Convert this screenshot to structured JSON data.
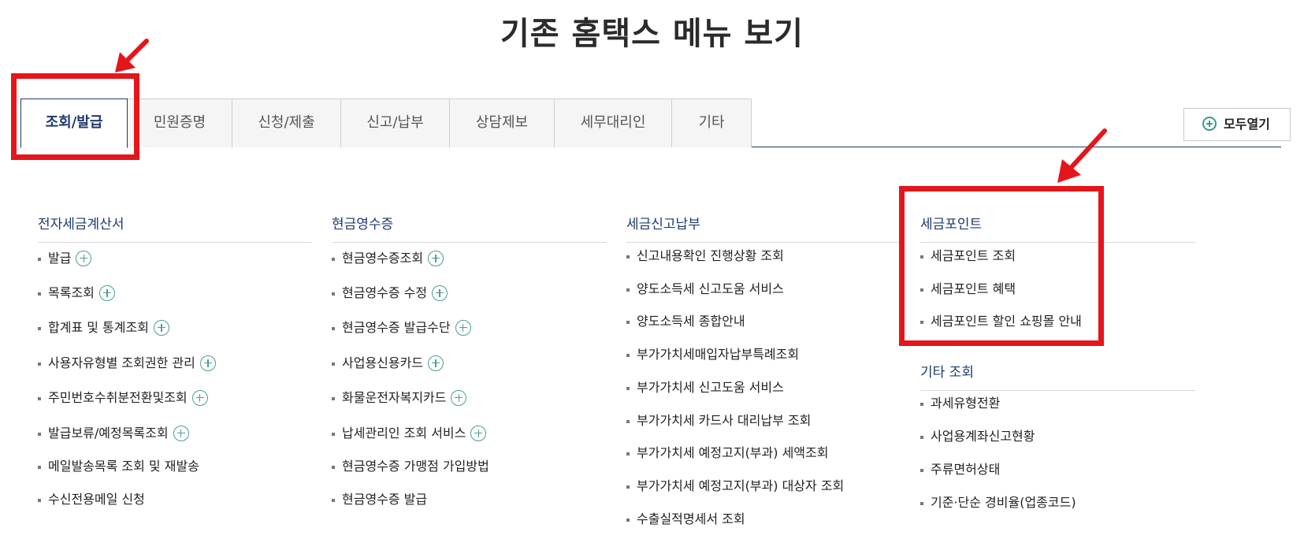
{
  "page_title": "기존 홈택스 메뉴 보기",
  "tabs": [
    {
      "label": "조회/발급",
      "active": true
    },
    {
      "label": "민원증명",
      "active": false
    },
    {
      "label": "신청/제출",
      "active": false
    },
    {
      "label": "신고/납부",
      "active": false
    },
    {
      "label": "상담제보",
      "active": false
    },
    {
      "label": "세무대리인",
      "active": false
    },
    {
      "label": "기타",
      "active": false
    }
  ],
  "expand_all_label": "모두열기",
  "columns": [
    {
      "heading": "전자세금계산서",
      "items": [
        {
          "label": "발급",
          "expandable": true
        },
        {
          "label": "목록조회",
          "expandable": true
        },
        {
          "label": "합계표 및 통계조회",
          "expandable": true
        },
        {
          "label": "사용자유형별 조회권한 관리",
          "expandable": true
        },
        {
          "label": "주민번호수취분전환및조회",
          "expandable": true
        },
        {
          "label": "발급보류/예정목록조회",
          "expandable": true
        },
        {
          "label": "메일발송목록 조회 및 재발송",
          "expandable": false
        },
        {
          "label": "수신전용메일 신청",
          "expandable": false
        }
      ]
    },
    {
      "heading": "현금영수증",
      "items": [
        {
          "label": "현금영수증조회",
          "expandable": true
        },
        {
          "label": "현금영수증 수정",
          "expandable": true
        },
        {
          "label": "현금영수증 발급수단",
          "expandable": true
        },
        {
          "label": "사업용신용카드",
          "expandable": true
        },
        {
          "label": "화물운전자복지카드",
          "expandable": true
        },
        {
          "label": "납세관리인 조회 서비스",
          "expandable": true
        },
        {
          "label": "현금영수증 가맹점 가입방법",
          "expandable": false
        },
        {
          "label": "현금영수증 발급",
          "expandable": false
        }
      ]
    },
    {
      "heading": "세금신고납부",
      "items": [
        {
          "label": "신고내용확인 진행상황 조회",
          "expandable": false
        },
        {
          "label": "양도소득세 신고도움 서비스",
          "expandable": false
        },
        {
          "label": "양도소득세 종합안내",
          "expandable": false
        },
        {
          "label": "부가가치세매입자납부특례조회",
          "expandable": false
        },
        {
          "label": "부가가치세 신고도움 서비스",
          "expandable": false
        },
        {
          "label": "부가가치세 카드사 대리납부 조회",
          "expandable": false
        },
        {
          "label": "부가가치세 예정고지(부과) 세액조회",
          "expandable": false
        },
        {
          "label": "부가가치세 예정고지(부과) 대상자 조회",
          "expandable": false
        },
        {
          "label": "수출실적명세서 조회",
          "expandable": false
        }
      ]
    },
    {
      "heading": "세금포인트",
      "items": [
        {
          "label": "세금포인트 조회",
          "expandable": false
        },
        {
          "label": "세금포인트 혜택",
          "expandable": false
        },
        {
          "label": "세금포인트 할인 쇼핑몰 안내",
          "expandable": false
        }
      ]
    },
    {
      "heading": "기타 조회",
      "items": [
        {
          "label": "과세유형전환",
          "expandable": false
        },
        {
          "label": "사업용계좌신고현황",
          "expandable": false
        },
        {
          "label": "주류면허상태",
          "expandable": false
        },
        {
          "label": "기준·단순 경비율(업종코드)",
          "expandable": false
        }
      ]
    }
  ],
  "colors": {
    "navy": "#1e3a6e",
    "annotation_red": "#e4161b",
    "plus_teal": "#4a9e93"
  }
}
